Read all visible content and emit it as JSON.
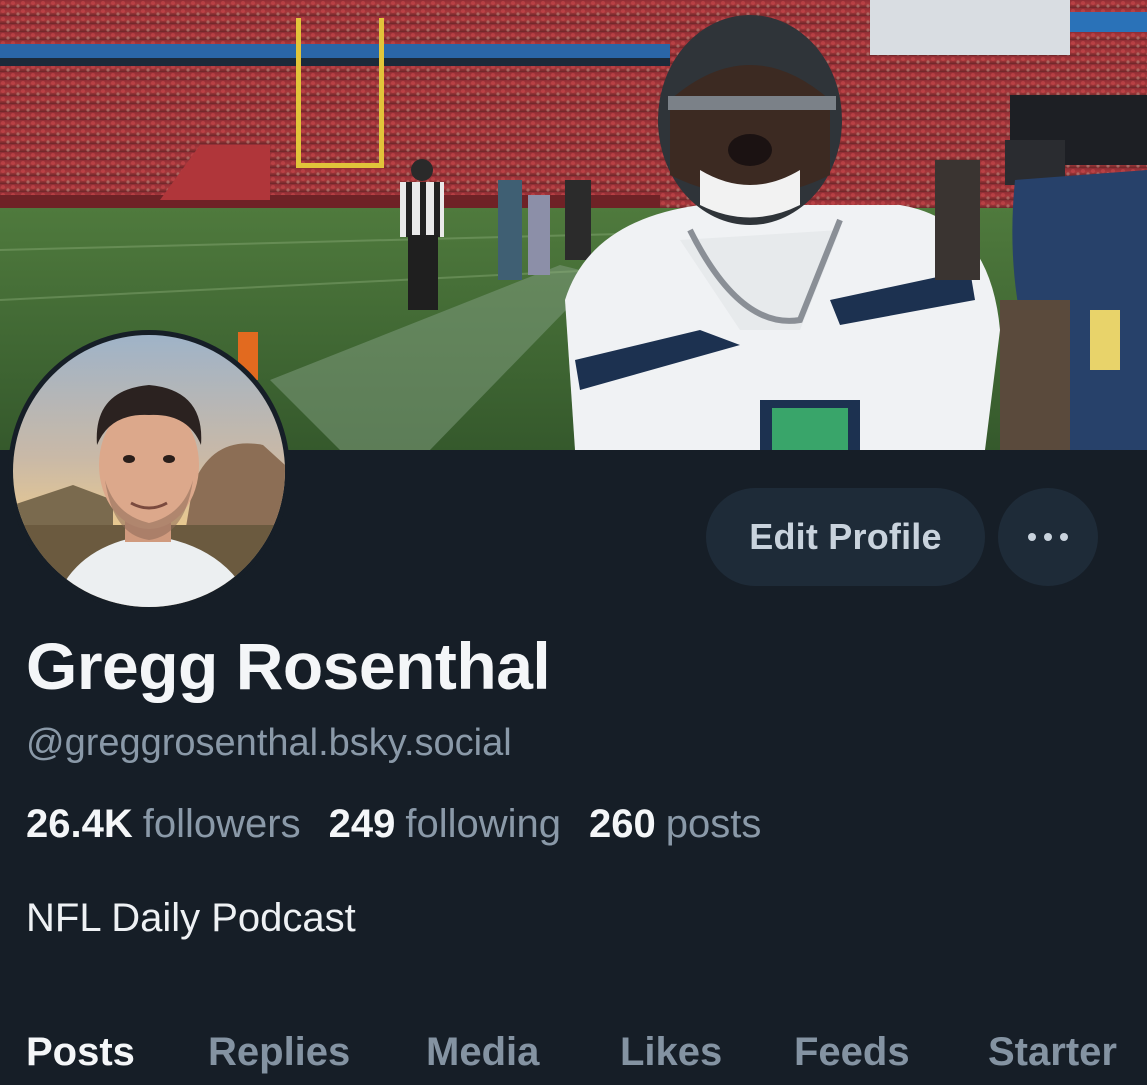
{
  "profile": {
    "display_name": "Gregg Rosenthal",
    "handle": "@greggrosenthal.bsky.social",
    "bio": "NFL Daily Podcast"
  },
  "stats": {
    "followers_count": "26.4K",
    "followers_label": "followers",
    "following_count": "249",
    "following_label": "following",
    "posts_count": "260",
    "posts_label": "posts"
  },
  "actions": {
    "edit_profile_label": "Edit Profile",
    "more_icon": "ellipsis-icon"
  },
  "tabs": [
    {
      "label": "Posts",
      "active": true
    },
    {
      "label": "Replies",
      "active": false
    },
    {
      "label": "Media",
      "active": false
    },
    {
      "label": "Likes",
      "active": false
    },
    {
      "label": "Feeds",
      "active": false
    },
    {
      "label": "Starter",
      "active": false
    }
  ],
  "colors": {
    "background": "#161e27",
    "button_bg": "#1e2b38",
    "muted_text": "#8a99a8",
    "primary_text": "#f4f6f8"
  }
}
